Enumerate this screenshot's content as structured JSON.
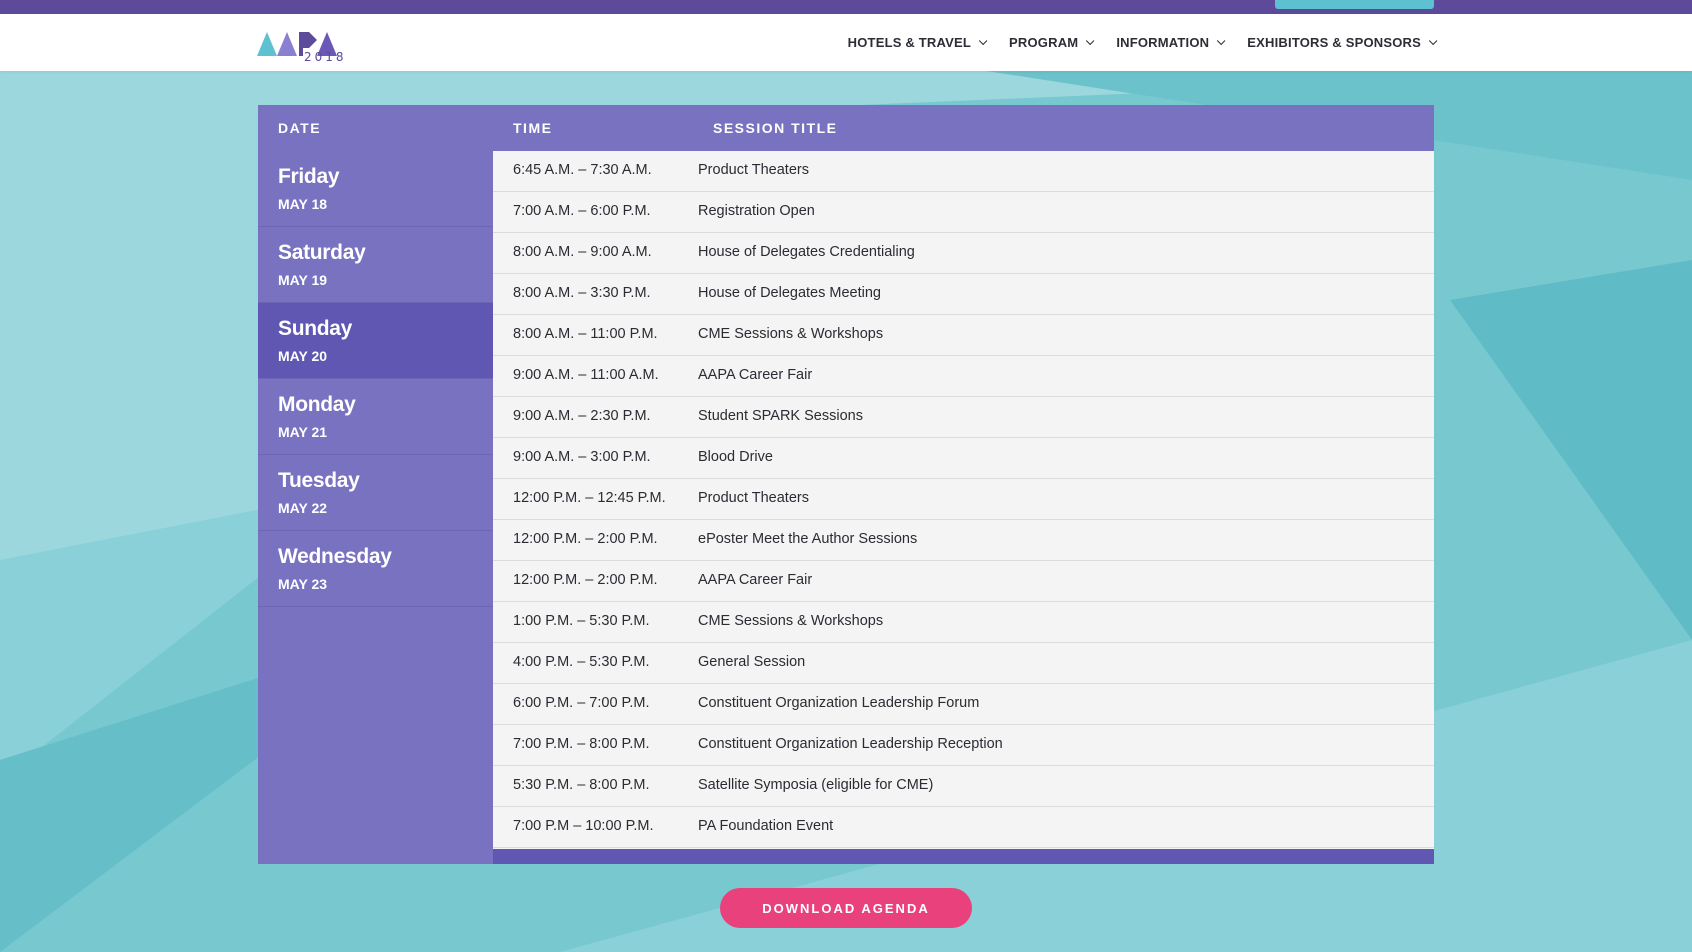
{
  "colors": {
    "topbar": "#5d4a9a",
    "header_bg": "#ffffff",
    "table_header": "#7872c0",
    "active_day": "#5f57b2",
    "cta": "#e9417b",
    "background": "#7fcad3"
  },
  "logo": {
    "year": "2018",
    "alt": "AAPA"
  },
  "nav": [
    {
      "label": "HOTELS & TRAVEL",
      "icon": "chevron-down-icon"
    },
    {
      "label": "PROGRAM",
      "icon": "chevron-down-icon"
    },
    {
      "label": "INFORMATION",
      "icon": "chevron-down-icon"
    },
    {
      "label": "EXHIBITORS & SPONSORS",
      "icon": "chevron-down-icon"
    }
  ],
  "agenda": {
    "headers": {
      "date": "DATE",
      "time": "TIME",
      "title": "SESSION TITLE"
    },
    "active_day": 2,
    "days": [
      {
        "name": "Friday",
        "date": "MAY 18"
      },
      {
        "name": "Saturday",
        "date": "MAY 19"
      },
      {
        "name": "Sunday",
        "date": "MAY 20"
      },
      {
        "name": "Monday",
        "date": "MAY 21"
      },
      {
        "name": "Tuesday",
        "date": "MAY 22"
      },
      {
        "name": "Wednesday",
        "date": "MAY 23"
      }
    ],
    "sessions": [
      {
        "time": "6:45 A.M. – 7:30 A.M.",
        "title": "Product Theaters"
      },
      {
        "time": "7:00 A.M. – 6:00 P.M.",
        "title": "Registration Open"
      },
      {
        "time": "8:00 A.M. – 9:00 A.M.",
        "title": "House of Delegates Credentialing"
      },
      {
        "time": "8:00 A.M. – 3:30 P.M.",
        "title": "House of Delegates Meeting"
      },
      {
        "time": "8:00 A.M. – 11:00 P.M.",
        "title": "CME Sessions & Workshops"
      },
      {
        "time": "9:00 A.M. – 11:00 A.M.",
        "title": "AAPA Career Fair"
      },
      {
        "time": "9:00 A.M. – 2:30 P.M.",
        "title": "Student SPARK Sessions"
      },
      {
        "time": "9:00 A.M. – 3:00 P.M.",
        "title": "Blood Drive"
      },
      {
        "time": "12:00 P.M. – 12:45 P.M.",
        "title": "Product Theaters"
      },
      {
        "time": "12:00 P.M. – 2:00 P.M.",
        "title": "ePoster Meet the Author Sessions"
      },
      {
        "time": "12:00 P.M. – 2:00 P.M.",
        "title": "AAPA Career Fair"
      },
      {
        "time": "1:00 P.M. – 5:30 P.M.",
        "title": "CME Sessions & Workshops"
      },
      {
        "time": "4:00 P.M. – 5:30 P.M.",
        "title": "General Session"
      },
      {
        "time": "6:00 P.M. – 7:00 P.M.",
        "title": "Constituent Organization Leadership Forum"
      },
      {
        "time": "7:00 P.M. – 8:00 P.M.",
        "title": "Constituent Organization Leadership Reception"
      },
      {
        "time": "5:30 P.M. – 8:00 P.M.",
        "title": "Satellite Symposia (eligible for CME)"
      },
      {
        "time": "7:00 P.M – 10:00 P.M.",
        "title": "PA Foundation Event"
      }
    ]
  },
  "download_label": "DOWNLOAD AGENDA"
}
